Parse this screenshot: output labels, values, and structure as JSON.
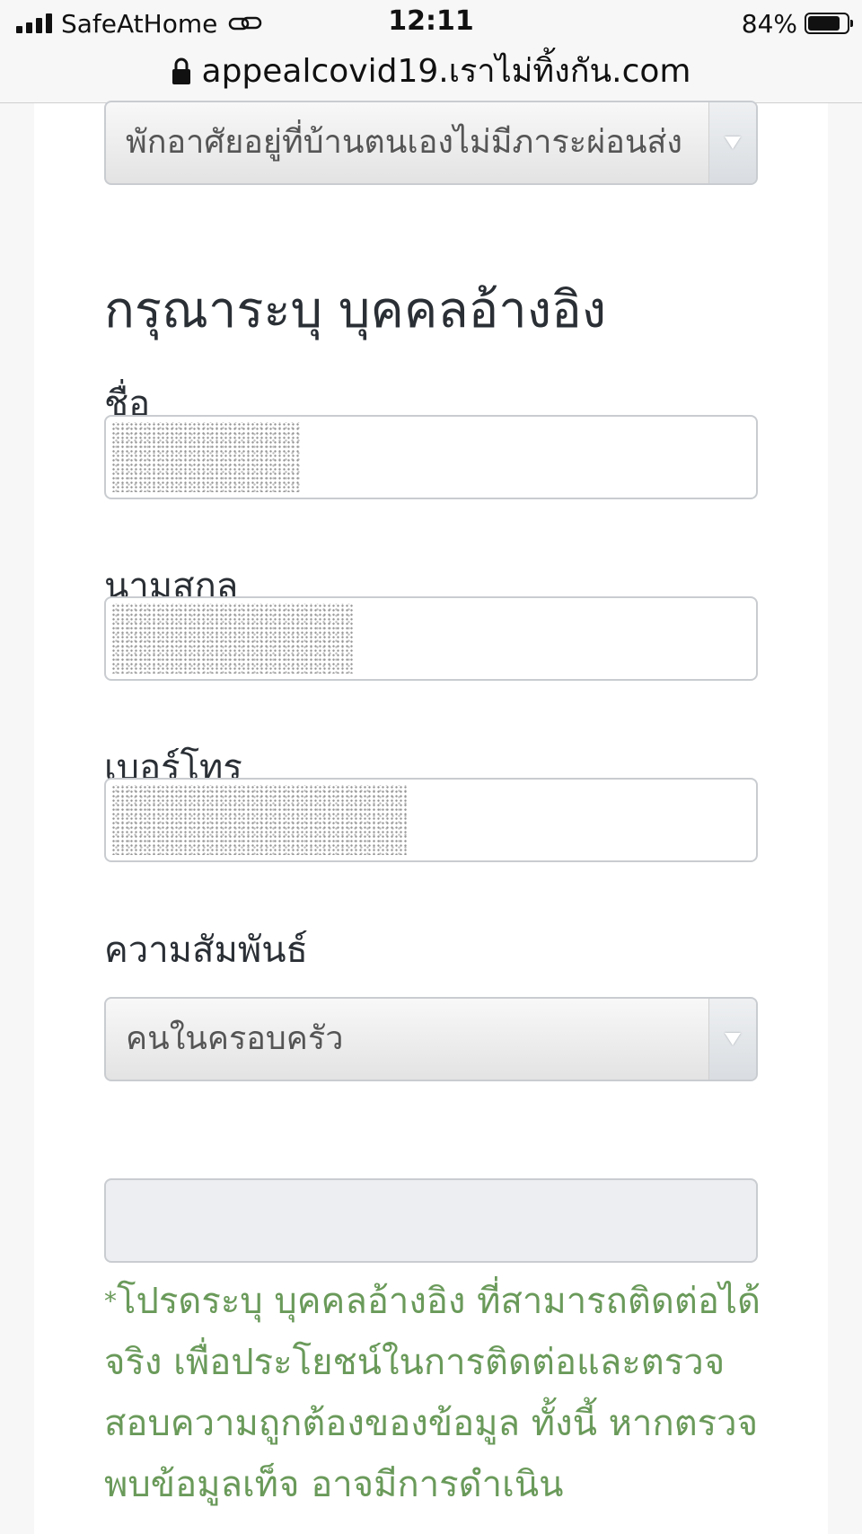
{
  "status_bar": {
    "carrier": "SafeAtHome",
    "time": "12:11",
    "battery_percent": "84%",
    "battery_level": 0.84
  },
  "url_bar": {
    "url": "appealcovid19.เราไม่ทิ้งกัน.com"
  },
  "form": {
    "living_select_value": "พักอาศัยอยู่ที่บ้านตนเองไม่มีภาระผ่อนส่ง",
    "reference_heading": "กรุณาระบุ บุคคลอ้างอิง",
    "first_name_label": "ชื่อ",
    "last_name_label": "นามสกุล",
    "phone_label": "เบอร์โทร",
    "relationship_label": "ความสัมพันธ์",
    "relationship_value": "คนในครอบครัว",
    "note_star": "*",
    "note_text": "โปรดระบุ บุคคลอ้างอิง ที่สามารถติดต่อได้จริง เพื่อประโยชน์ในการติดต่อและตรวจสอบความถูกต้องของข้อมูล ทั้งนี้ หากตรวจพบข้อมูลเท็จ อาจมีการดำเนิน"
  },
  "colors": {
    "note_green": "#6a9a5a",
    "text_dark": "#2a2f35"
  }
}
